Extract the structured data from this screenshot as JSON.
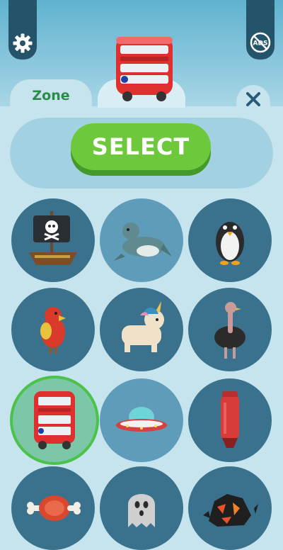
{
  "header": {
    "settings_icon": "gear-icon",
    "no_ads_label": "ADS",
    "no_ads_icon": "no-ads-icon"
  },
  "tabs": {
    "zone_label": "Zone",
    "close_icon": "close-icon"
  },
  "actions": {
    "select_label": "SELECT"
  },
  "skins": [
    {
      "name": "pirate-ship",
      "selected": false
    },
    {
      "name": "seal",
      "selected": false
    },
    {
      "name": "penguin",
      "selected": false
    },
    {
      "name": "parrot",
      "selected": false
    },
    {
      "name": "unicorn",
      "selected": false
    },
    {
      "name": "ostrich",
      "selected": false
    },
    {
      "name": "double-decker-bus",
      "selected": true
    },
    {
      "name": "ufo",
      "selected": false
    },
    {
      "name": "highlighter",
      "selected": false
    },
    {
      "name": "meat",
      "selected": false
    },
    {
      "name": "ghost",
      "selected": false
    },
    {
      "name": "lava-rock",
      "selected": false
    }
  ],
  "colors": {
    "accent_green": "#6ec83c",
    "selected_ring": "#4bc24a",
    "panel_bg": "#c6e4ee",
    "circle_dark": "#3a728e"
  }
}
